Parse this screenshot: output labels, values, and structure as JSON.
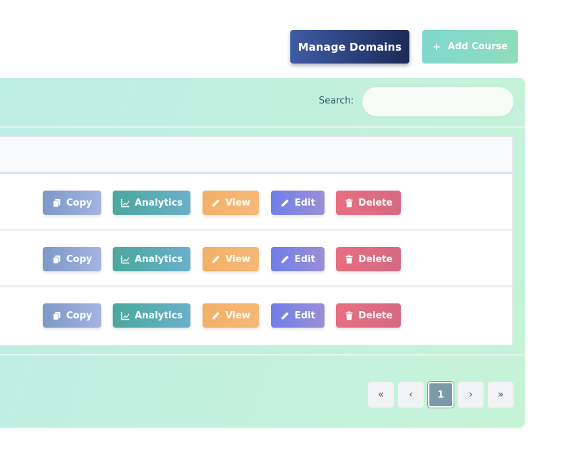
{
  "header": {
    "manage_domains_label": "Manage Domains",
    "add_course_label": "Add Course",
    "add_course_icon": "+"
  },
  "search": {
    "label": "Search:",
    "value": "",
    "placeholder": ""
  },
  "actions": {
    "copy": "Copy",
    "analytics": "Analytics",
    "view": "View",
    "edit": "Edit",
    "delete": "Delete"
  },
  "rows": [
    {
      "actions": [
        "copy",
        "analytics",
        "view",
        "edit",
        "delete"
      ]
    },
    {
      "actions": [
        "copy",
        "analytics",
        "view",
        "edit",
        "delete"
      ]
    },
    {
      "actions": [
        "copy",
        "analytics",
        "view",
        "edit",
        "delete"
      ]
    }
  ],
  "pagination": {
    "first": "«",
    "prev": "‹",
    "current": "1",
    "next": "›",
    "last": "»"
  },
  "icons": {
    "copy": "copy-icon",
    "analytics": "chart-line-icon",
    "view": "pencil-icon",
    "edit": "pencil-icon",
    "delete": "trash-icon"
  },
  "colors": {
    "manage_domains": "#2b3d78",
    "add_course": "#7ed8cc",
    "copy": "#7d98c8",
    "analytics": "#4aa89c",
    "view": "#f2b066",
    "edit": "#6f7fe8",
    "delete": "#e76e80",
    "pagination_active": "#7a9aa8"
  }
}
